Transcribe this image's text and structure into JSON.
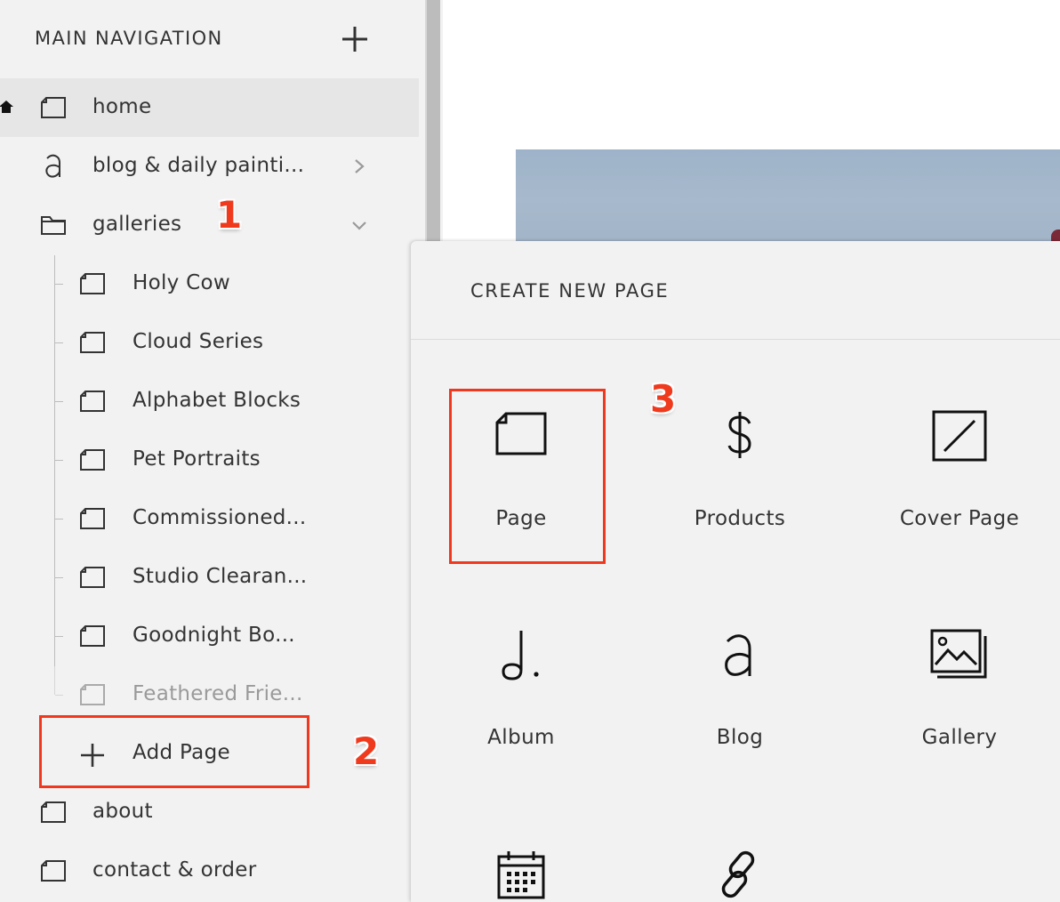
{
  "sidebar": {
    "title": "MAIN NAVIGATION",
    "items": [
      {
        "label": "home",
        "icon": "page-icon",
        "home": true
      },
      {
        "label": "blog & daily painti...",
        "icon": "blog-icon"
      },
      {
        "label": "galleries",
        "icon": "folder-icon"
      },
      {
        "label": "Holy Cow",
        "icon": "page-icon"
      },
      {
        "label": "Cloud Series",
        "icon": "page-icon"
      },
      {
        "label": "Alphabet Blocks",
        "icon": "page-icon"
      },
      {
        "label": "Pet Portraits",
        "icon": "page-icon"
      },
      {
        "label": "Commissioned...",
        "icon": "page-icon"
      },
      {
        "label": "Studio Clearan...",
        "icon": "page-icon"
      },
      {
        "label": "Goodnight Bo...",
        "icon": "page-icon"
      },
      {
        "label": "Feathered Frie...",
        "icon": "page-icon"
      },
      {
        "label": "about",
        "icon": "page-icon"
      },
      {
        "label": "contact & order",
        "icon": "page-icon"
      }
    ],
    "add_page_label": "Add Page"
  },
  "panel": {
    "title": "CREATE NEW PAGE",
    "tiles": [
      {
        "label": "Page",
        "icon": "page-icon"
      },
      {
        "label": "Products",
        "icon": "dollar-icon"
      },
      {
        "label": "Cover Page",
        "icon": "cover-page-icon"
      },
      {
        "label": "Album",
        "icon": "album-icon"
      },
      {
        "label": "Blog",
        "icon": "blog-icon"
      },
      {
        "label": "Gallery",
        "icon": "gallery-icon"
      },
      {
        "label": "",
        "icon": "calendar-icon"
      },
      {
        "label": "",
        "icon": "link-icon"
      }
    ]
  },
  "annotations": [
    "1",
    "2",
    "3"
  ],
  "colors": {
    "annotation": "#f0381f",
    "panel_bg": "#f2f2f2",
    "active_row": "#e6e6e6"
  }
}
